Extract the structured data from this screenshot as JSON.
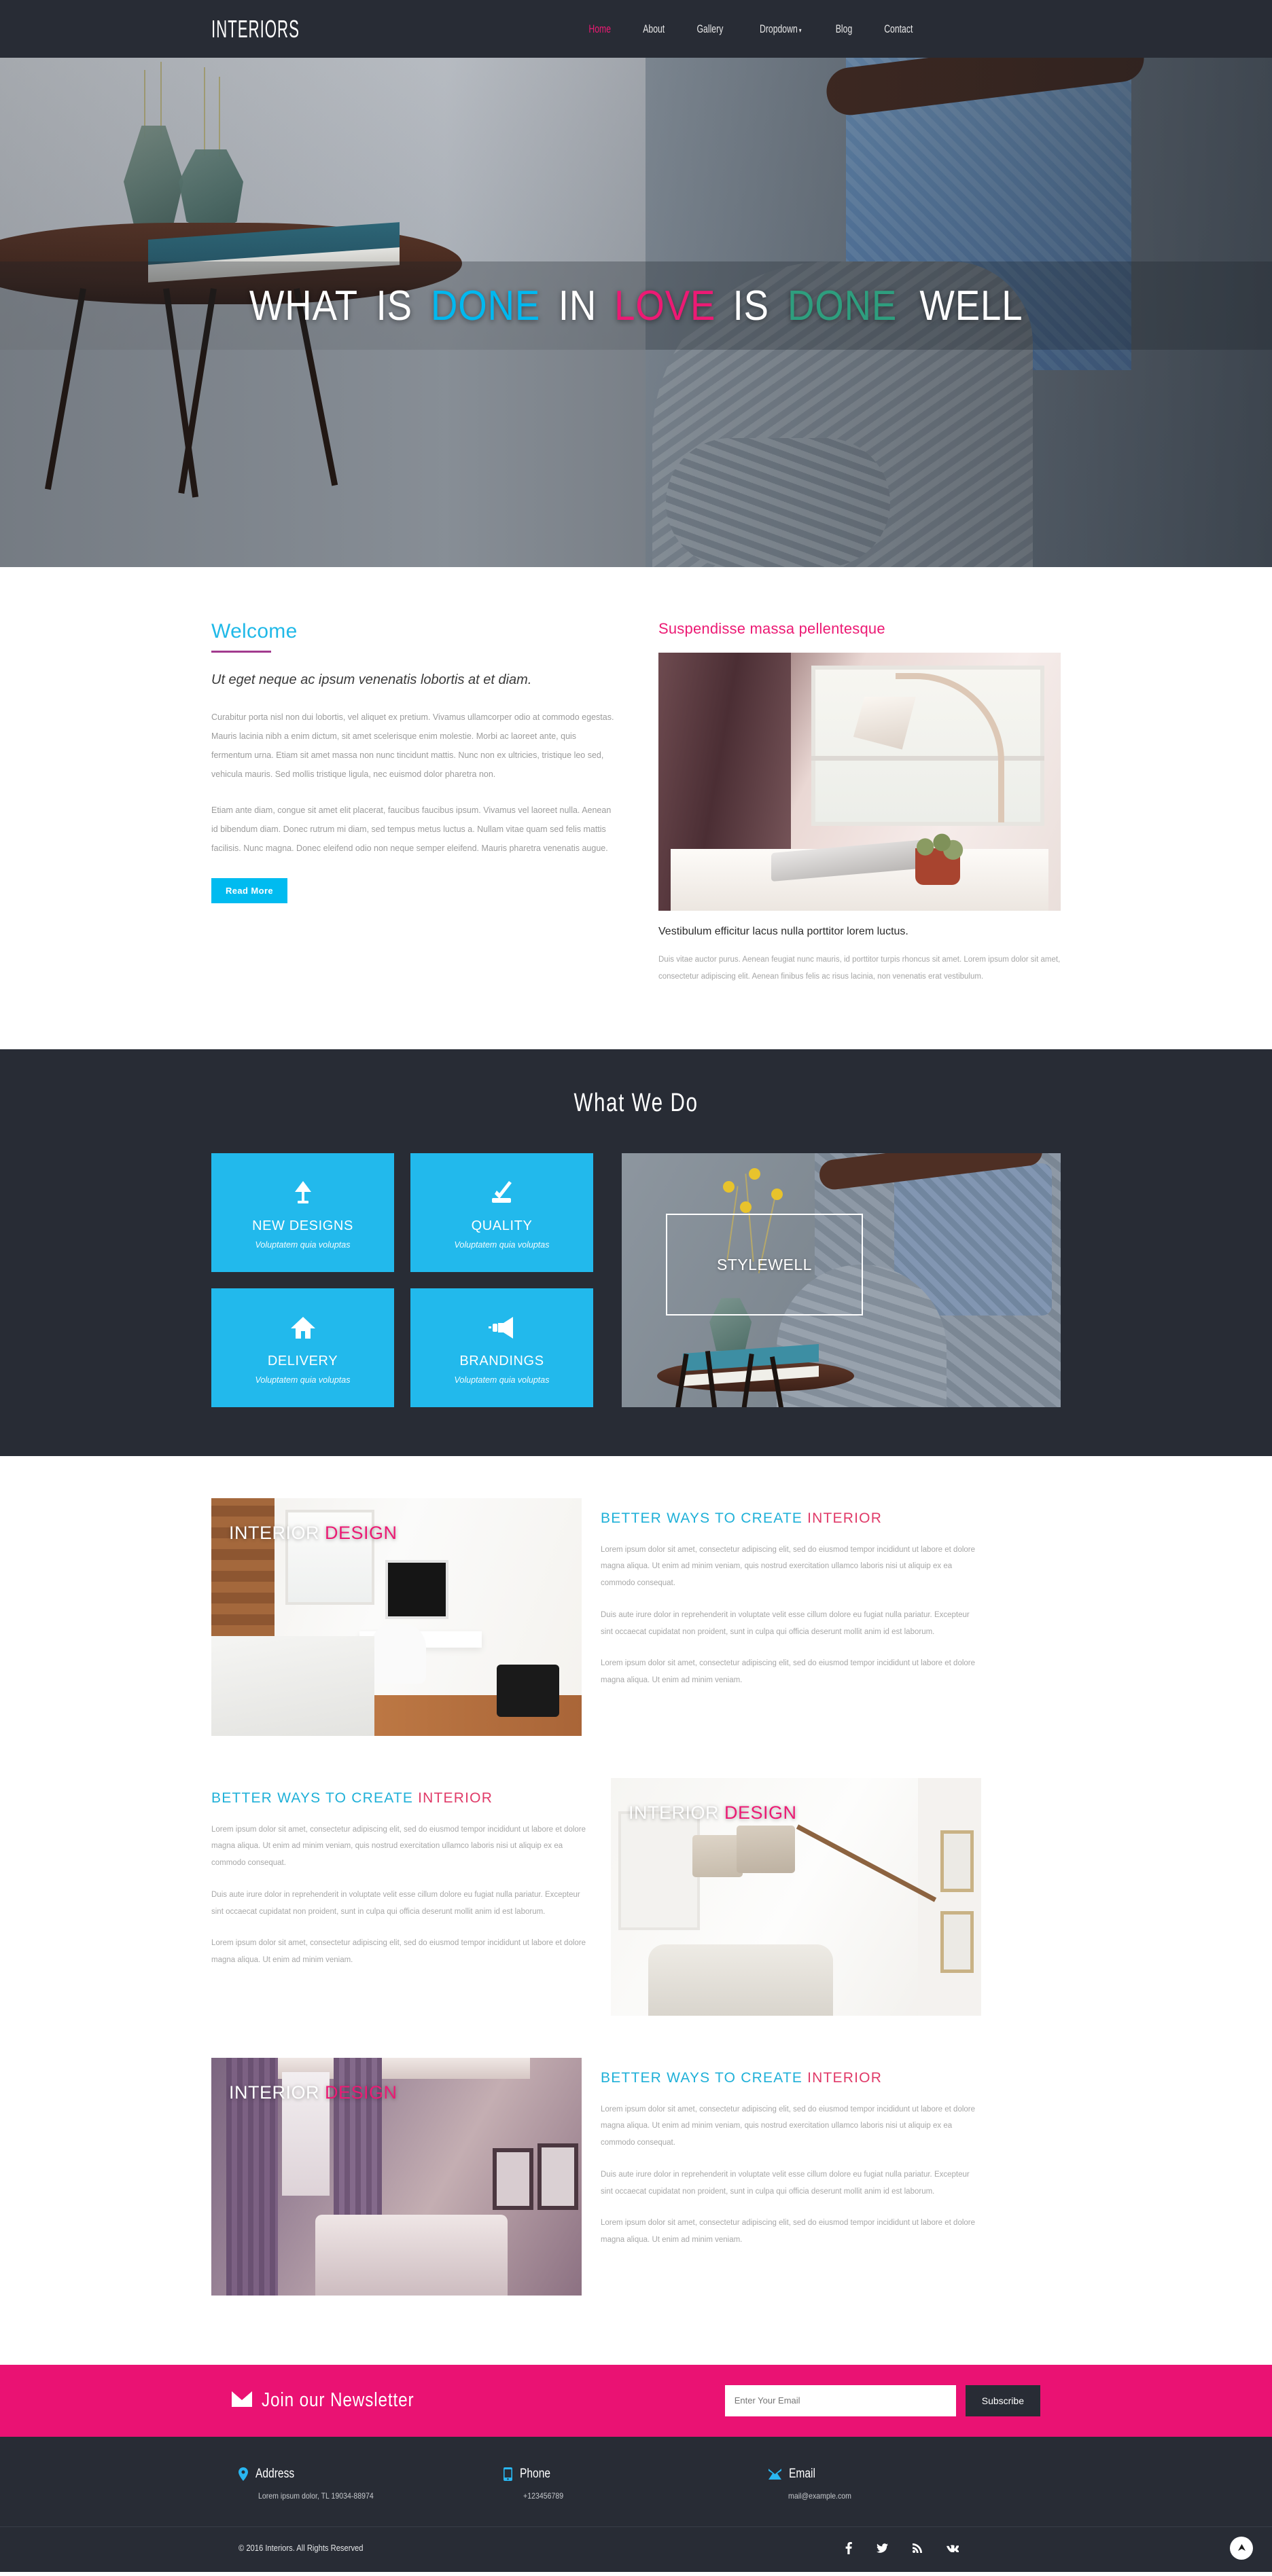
{
  "header": {
    "logo": "INTERIORS",
    "nav": [
      {
        "label": "Home",
        "active": true
      },
      {
        "label": "About",
        "active": false
      },
      {
        "label": "Gallery",
        "active": false
      },
      {
        "label": "Dropdown",
        "active": false,
        "caret": "▾"
      },
      {
        "label": "Blog",
        "active": false
      },
      {
        "label": "Contact",
        "active": false
      }
    ]
  },
  "hero": {
    "words": [
      {
        "text": "WHAT",
        "color": "white"
      },
      {
        "text": "IS",
        "color": "white"
      },
      {
        "text": "DONE",
        "color": "cyan"
      },
      {
        "text": "IN",
        "color": "white"
      },
      {
        "text": "LOVE",
        "color": "pink"
      },
      {
        "text": "IS",
        "color": "white"
      },
      {
        "text": "DONE",
        "color": "green"
      },
      {
        "text": "WELL",
        "color": "white"
      }
    ]
  },
  "welcome": {
    "heading": "Welcome",
    "lead": "Ut eget neque ac ipsum venenatis lobortis at et diam.",
    "paragraph1": "Curabitur porta nisl non dui lobortis, vel aliquet ex pretium. Vivamus ullamcorper odio at commodo egestas. Mauris lacinia nibh a enim dictum, sit amet scelerisque enim molestie. Morbi ac laoreet ante, quis fermentum urna. Etiam sit amet massa non nunc tincidunt mattis. Nunc non ex ultricies, tristique leo sed, vehicula mauris. Sed mollis tristique ligula, nec euismod dolor pharetra non.",
    "paragraph2": "Etiam ante diam, congue sit amet elit placerat, faucibus faucibus ipsum. Vivamus vel laoreet nulla. Aenean id bibendum diam. Donec rutrum mi diam, sed tempus metus luctus a. Nullam vitae quam sed felis mattis facilisis. Nunc magna. Donec eleifend odio non neque semper eleifend. Mauris pharetra venenatis augue.",
    "read_more": "Read More",
    "right_heading": "Suspendisse massa pellentesque",
    "caption": "Vestibulum efficitur lacus nulla porttitor lorem luctus.",
    "right_paragraph": "Duis vitae auctor purus. Aenean feugiat nunc mauris, id porttitor turpis rhoncus sit amet. Lorem ipsum dolor sit amet, consectetur adipiscing elit. Aenean finibus felis ac risus lacinia, non venenatis erat vestibulum."
  },
  "what_we_do": {
    "heading": "What We Do",
    "tiles": [
      {
        "icon": "lamp-icon",
        "title": "NEW DESIGNS",
        "subtitle": "Voluptatem quia voluptas"
      },
      {
        "icon": "check-badge-icon",
        "title": "QUALITY",
        "subtitle": "Voluptatem quia voluptas"
      },
      {
        "icon": "home-icon",
        "title": "DELIVERY",
        "subtitle": "Voluptatem quia voluptas"
      },
      {
        "icon": "megaphone-icon",
        "title": "BRANDINGS",
        "subtitle": "Voluptatem quia voluptas"
      }
    ],
    "feature_label": "STYLEWELL"
  },
  "gallery": {
    "rows": [
      {
        "image_side": "left",
        "overlay_white": "INTERIOR",
        "overlay_pink": "DESIGN",
        "heading_blue": "BETTER WAYS TO CREATE",
        "heading_pink": "INTERIOR",
        "p1": "Lorem ipsum dolor sit amet, consectetur adipiscing elit, sed do eiusmod tempor incididunt ut labore et dolore magna aliqua. Ut enim ad minim veniam, quis nostrud exercitation ullamco laboris nisi ut aliquip ex ea commodo consequat.",
        "p2": "Duis aute irure dolor in reprehenderit in voluptate velit esse cillum dolore eu fugiat nulla pariatur. Excepteur sint occaecat cupidatat non proident, sunt in culpa qui officia deserunt mollit anim id est laborum.",
        "p3": "Lorem ipsum dolor sit amet, consectetur adipiscing elit, sed do eiusmod tempor incididunt ut labore et dolore magna aliqua. Ut enim ad minim veniam."
      },
      {
        "image_side": "right",
        "overlay_white": "INTERIOR",
        "overlay_pink": "DESIGN",
        "heading_blue": "BETTER WAYS TO CREATE",
        "heading_pink": "INTERIOR",
        "p1": "Lorem ipsum dolor sit amet, consectetur adipiscing elit, sed do eiusmod tempor incididunt ut labore et dolore magna aliqua. Ut enim ad minim veniam, quis nostrud exercitation ullamco laboris nisi ut aliquip ex ea commodo consequat.",
        "p2": "Duis aute irure dolor in reprehenderit in voluptate velit esse cillum dolore eu fugiat nulla pariatur. Excepteur sint occaecat cupidatat non proident, sunt in culpa qui officia deserunt mollit anim id est laborum.",
        "p3": "Lorem ipsum dolor sit amet, consectetur adipiscing elit, sed do eiusmod tempor incididunt ut labore et dolore magna aliqua. Ut enim ad minim veniam."
      },
      {
        "image_side": "left",
        "overlay_white": "INTERIOR",
        "overlay_pink": "DESIGN",
        "heading_blue": "BETTER WAYS TO CREATE",
        "heading_pink": "INTERIOR",
        "p1": "Lorem ipsum dolor sit amet, consectetur adipiscing elit, sed do eiusmod tempor incididunt ut labore et dolore magna aliqua. Ut enim ad minim veniam, quis nostrud exercitation ullamco laboris nisi ut aliquip ex ea commodo consequat.",
        "p2": "Duis aute irure dolor in reprehenderit in voluptate velit esse cillum dolore eu fugiat nulla pariatur. Excepteur sint occaecat cupidatat non proident, sunt in culpa qui officia deserunt mollit anim id est laborum.",
        "p3": "Lorem ipsum dolor sit amet, consectetur adipiscing elit, sed do eiusmod tempor incididunt ut labore et dolore magna aliqua. Ut enim ad minim veniam."
      }
    ]
  },
  "newsletter": {
    "title": "Join our Newsletter",
    "placeholder": "Enter Your Email",
    "value": "",
    "button": "Subscribe"
  },
  "footer": {
    "contacts": [
      {
        "icon": "location-pin-icon",
        "label": "Address",
        "value": "Lorem ipsum dolor, TL 19034-88974"
      },
      {
        "icon": "phone-icon",
        "label": "Phone",
        "value": "+123456789"
      },
      {
        "icon": "envelope-icon",
        "label": "Email",
        "value": "mail@example.com"
      }
    ],
    "copyright": "© 2016 Interiors. All Rights Reserved",
    "socials": [
      "facebook-icon",
      "twitter-icon",
      "rss-icon",
      "vk-icon"
    ]
  },
  "colors": {
    "dark": "#282c35",
    "cyan": "#00bbf0",
    "pink": "#ec1a74",
    "green": "#2e9e7e",
    "tile_blue": "#22b9ec",
    "newsletter_pink": "#ea1273"
  }
}
